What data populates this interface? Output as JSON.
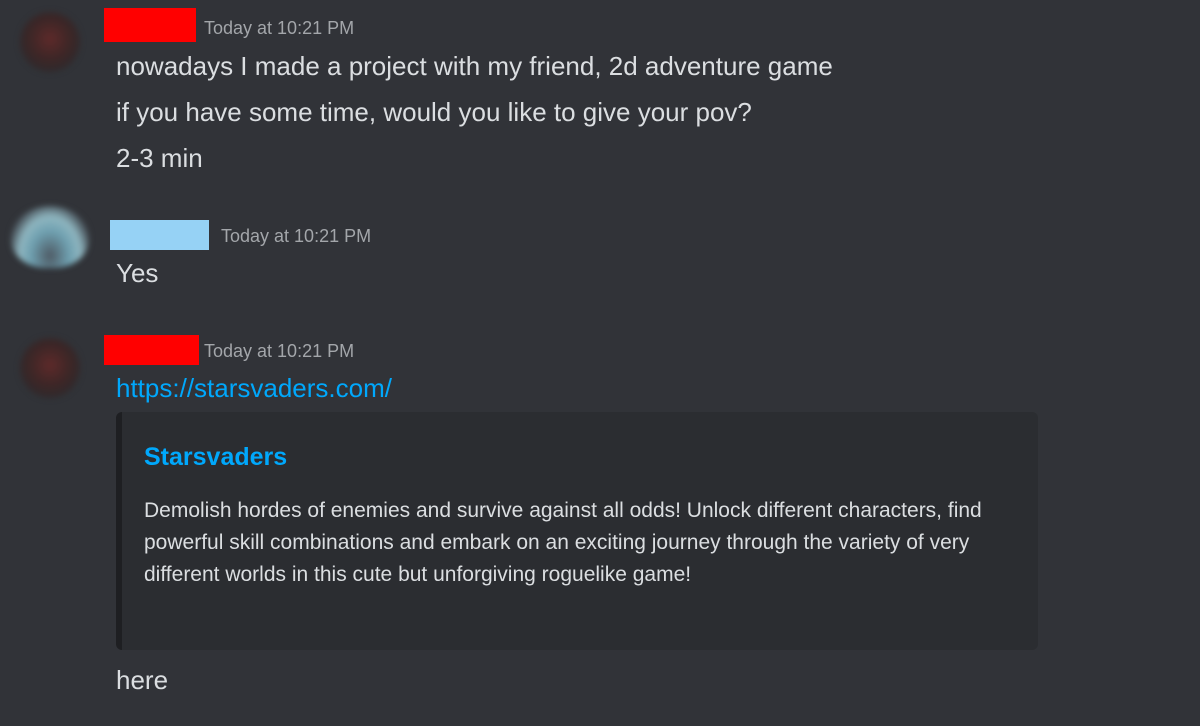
{
  "messages": [
    {
      "timestamp": "Today at 10:21 PM",
      "lines": [
        "nowadays I made a project with my friend, 2d adventure game",
        "if you have some time, would you like to give your pov?",
        "2-3 min"
      ]
    },
    {
      "timestamp": "Today at 10:21 PM",
      "lines": [
        "Yes"
      ]
    },
    {
      "timestamp": "Today at 10:21 PM",
      "link": "https://starsvaders.com/",
      "embed": {
        "title": "Starsvaders",
        "description": "Demolish hordes of enemies and survive against all odds! Unlock different characters, find powerful skill combinations and embark on an exciting journey through the variety of very different worlds in this cute but unforgiving roguelike game!"
      },
      "after_embed": "here"
    }
  ],
  "colors": {
    "background": "#313338",
    "link": "#00a8fc",
    "redact_red": "#ff0000",
    "redact_blue": "#96d2f5"
  }
}
